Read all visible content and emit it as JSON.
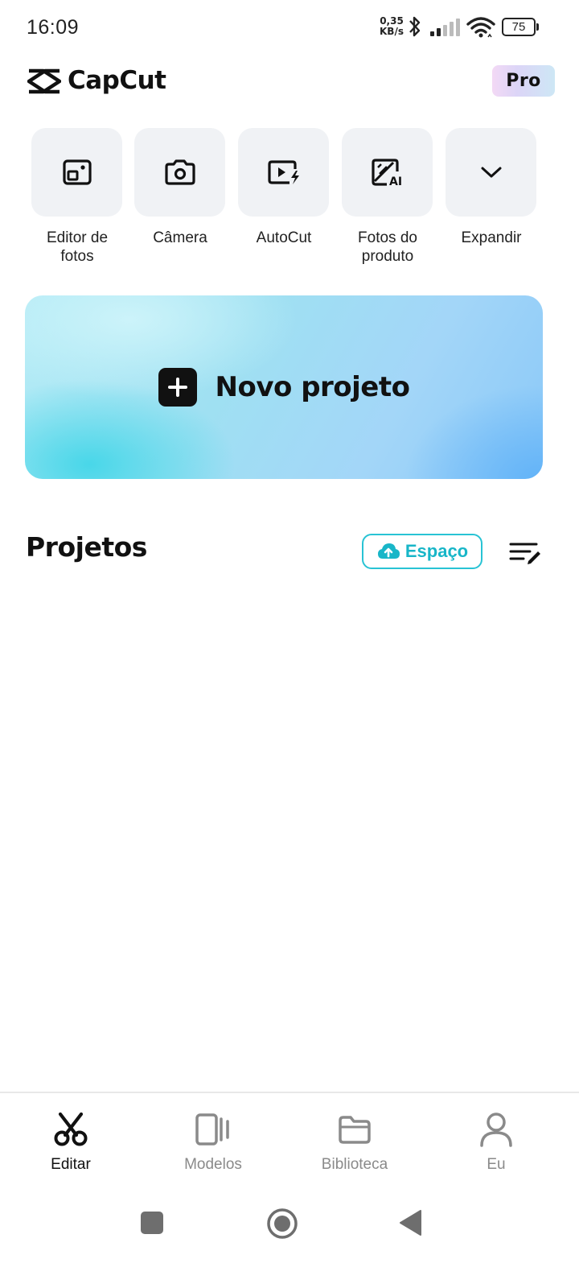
{
  "status_bar": {
    "time": "16:09",
    "net_speed_value": "0,35",
    "net_speed_unit": "KB/s",
    "battery_level": "75"
  },
  "header": {
    "app_name": "CapCut",
    "pro_label": "Pro"
  },
  "tools": [
    {
      "label": "Editor de\nfotos",
      "icon": "photo-editor-icon"
    },
    {
      "label": "Câmera",
      "icon": "camera-icon"
    },
    {
      "label": "AutoCut",
      "icon": "autocut-icon"
    },
    {
      "label": "Fotos do\nproduto",
      "icon": "product-photos-ai-icon"
    },
    {
      "label": "Expandir",
      "icon": "chevron-down-icon"
    }
  ],
  "new_project": {
    "label": "Novo projeto"
  },
  "projects": {
    "title": "Projetos",
    "space_label": "Espaço"
  },
  "bottom_nav": [
    {
      "label": "Editar",
      "icon": "scissors-icon",
      "active": true
    },
    {
      "label": "Modelos",
      "icon": "templates-icon",
      "active": false
    },
    {
      "label": "Biblioteca",
      "icon": "folder-icon",
      "active": false
    },
    {
      "label": "Eu",
      "icon": "person-icon",
      "active": false
    }
  ],
  "colors": {
    "accent_cyan": "#18b6c8",
    "tile_bg": "#f0f2f5",
    "text_dark": "#111111",
    "text_muted": "#8a8a8a"
  }
}
